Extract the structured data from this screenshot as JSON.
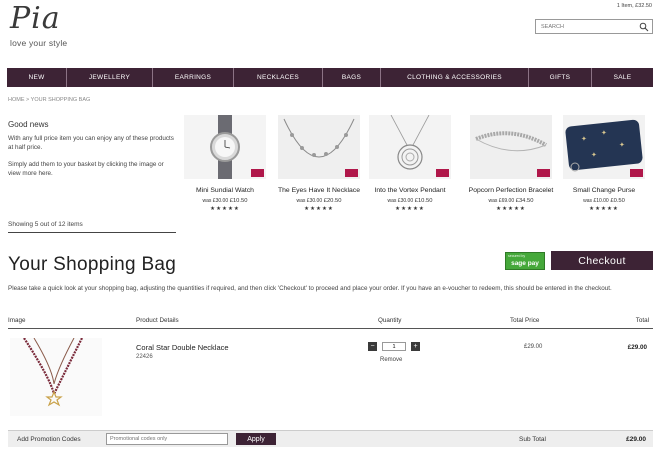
{
  "brand": {
    "logo_text": "Pia",
    "tagline": "love your style"
  },
  "header": {
    "basket_summary": "1 Item, £32.50",
    "search_placeholder": "SEARCH",
    "search_icon": "magnifier-icon"
  },
  "nav": {
    "items": [
      {
        "label": "NEW"
      },
      {
        "label": "JEWELLERY"
      },
      {
        "label": "EARRINGS"
      },
      {
        "label": "NECKLACES"
      },
      {
        "label": "BAGS"
      },
      {
        "label": "CLOTHING & ACCESSORIES"
      },
      {
        "label": "GIFTS"
      },
      {
        "label": "SALE"
      }
    ],
    "background": "#3d2335"
  },
  "breadcrumb": "HOME > YOUR SHOPPING BAG",
  "good_news": {
    "title": "Good news",
    "text1": "With any full price item you can enjoy any of these products at half price.",
    "text2": "Simply add them to your basket by clicking the image or view more here.",
    "showing": "Showing 5 out of 12 items"
  },
  "offers": [
    {
      "name": "Mini Sundial Watch",
      "was": "was £30.00",
      "now": "£10.50",
      "stars": "★★★★★",
      "icon": "watch-icon"
    },
    {
      "name": "The Eyes Have It Necklace",
      "was": "was £30.00",
      "now": "£20.50",
      "stars": "★★★★★",
      "icon": "necklace-icon"
    },
    {
      "name": "Into the Vortex Pendant",
      "was": "was £30.00",
      "now": "£10.50",
      "stars": "★★★★★",
      "icon": "pendant-icon"
    },
    {
      "name": "Popcorn Perfection Bracelet",
      "was": "was £69.00",
      "now": "£34.50",
      "stars": "★★★★★",
      "icon": "bracelet-icon"
    },
    {
      "name": "Small Change Purse",
      "was": "was £10.00",
      "now": "£0.50",
      "stars": "★★★★★",
      "icon": "purse-icon"
    }
  ],
  "bag": {
    "title": "Your Shopping Bag",
    "sagepay_top": "secured by",
    "sagepay_label": "sage pay",
    "checkout_label": "Checkout",
    "intro": "Please take a quick look at your shopping bag, adjusting the quantities if required, and then click 'Checkout' to proceed and place your order. If you have an e-voucher to redeem, this should be entered in the checkout.",
    "columns": {
      "image": "Image",
      "details": "Product Details",
      "quantity": "Quantity",
      "total_price": "Total Price",
      "total": "Total"
    },
    "items": [
      {
        "name": "Coral Star Double Necklace",
        "code": "22426",
        "quantity": "1",
        "remove_label": "Remove",
        "total_price": "£29.00",
        "total": "£29.00",
        "icon": "necklace-star-icon"
      }
    ],
    "promo_label": "Add Promotion Codes",
    "promo_placeholder": "Promotional codes only",
    "apply_label": "Apply",
    "subtotal_label": "Sub Total",
    "subtotal_value": "£29.00"
  },
  "colors": {
    "brand_plum": "#3d2335",
    "badge_red": "#b0174a",
    "sagepay_green": "#45a83a"
  }
}
